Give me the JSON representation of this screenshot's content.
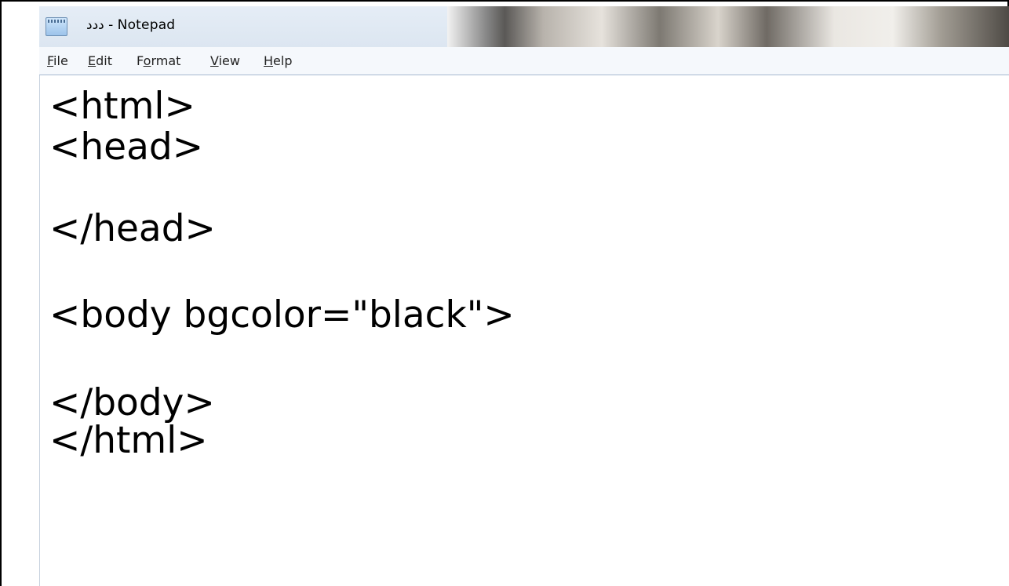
{
  "window": {
    "title": "ددد - Notepad"
  },
  "menubar": {
    "items": [
      {
        "first": "F",
        "rest": "ile"
      },
      {
        "first": "E",
        "rest": "dit"
      },
      {
        "first": "F",
        "mid": "o",
        "rest": "rmat"
      },
      {
        "first": "V",
        "rest": "iew"
      },
      {
        "first": "H",
        "rest": "elp"
      }
    ]
  },
  "editor": {
    "lines": [
      "<html>",
      "<head>",
      "",
      "</head>",
      "",
      "<body bgcolor=\"black\">",
      "",
      "</body>",
      "</html>"
    ]
  }
}
